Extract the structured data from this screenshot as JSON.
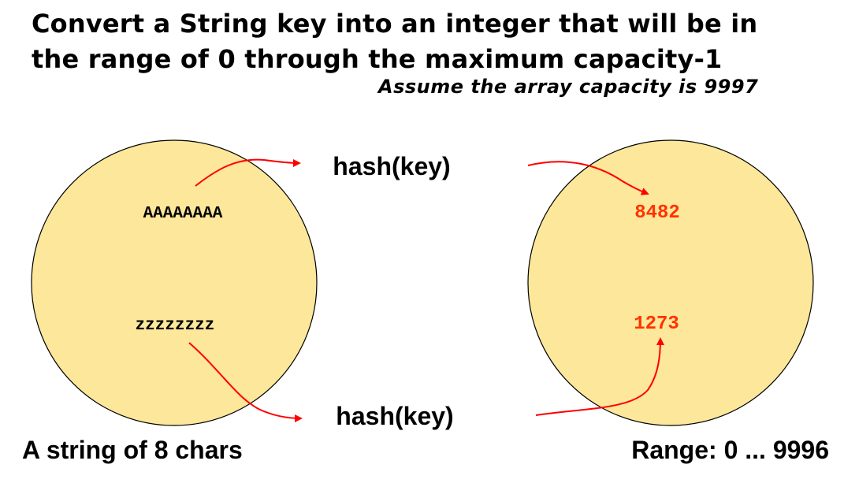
{
  "heading": {
    "title_line1": "Convert a String key into an integer that will be in",
    "title_line2": "the range of 0 through the maximum capacity-1",
    "note": "Assume the array capacity is 9997"
  },
  "diagram": {
    "keys": [
      "AAAAAAAA",
      "zzzzzzzz"
    ],
    "hash_label": "hash(key)",
    "hash_values": [
      "8482",
      "1273"
    ],
    "domain_caption": "A string of 8 chars",
    "range_caption": "Range: 0 ... 9996",
    "circle_fill": "#fce79a",
    "arrow_color": "#ff0000",
    "value_color": "#ff3300"
  }
}
